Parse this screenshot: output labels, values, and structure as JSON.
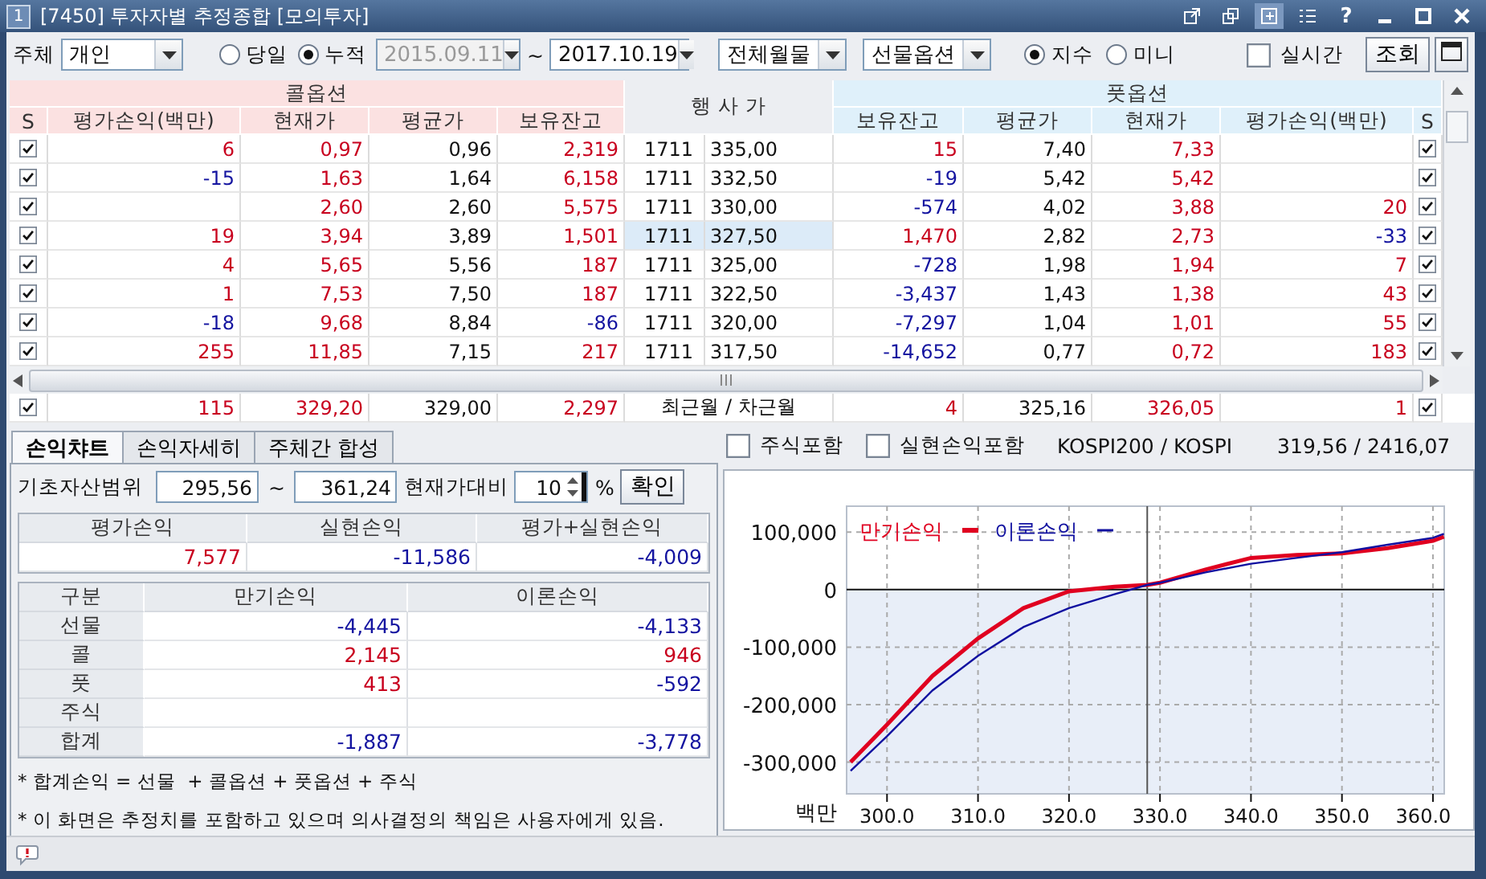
{
  "window": {
    "badge": "1",
    "title": "[7450] 투자자별 추정종합 [모의투자]",
    "help": "?"
  },
  "toolbar": {
    "subject_label": "주체",
    "subject": "개인",
    "period_radios": [
      {
        "label": "당일",
        "selected": false
      },
      {
        "label": "누적",
        "selected": true
      }
    ],
    "start_date": {
      "value": "2015.09.11",
      "disabled": true
    },
    "tilde": "~",
    "end_date": "2017.10.19",
    "month_select": "전체월물",
    "product_select": "선물옵션",
    "index_radios": [
      {
        "label": "지수",
        "selected": true
      },
      {
        "label": "미니",
        "selected": false
      }
    ],
    "realtime": {
      "label": "실시간",
      "checked": false
    },
    "query_button": "조회"
  },
  "grid": {
    "call_group": "콜옵션",
    "strike_header": "행 사 가",
    "put_group": "풋옵션",
    "call_columns": [
      "S",
      "평가손익(백만)",
      "현재가",
      "평균가",
      "보유잔고"
    ],
    "put_columns": [
      "보유잔고",
      "평균가",
      "현재가",
      "평가손익(백만)",
      "S"
    ],
    "rows": [
      {
        "call_checked": true,
        "call_pl": "6",
        "call_price": "0,97",
        "call_avg": "0,96",
        "call_balance": "2,319",
        "month": "1711",
        "strike": "335,00",
        "highlighted": false,
        "put_balance": "15",
        "put_avg": "7,40",
        "put_price": "7,33",
        "put_checked": true
      },
      {
        "call_checked": true,
        "call_pl": "-15",
        "call_price": "1,63",
        "call_avg": "1,64",
        "call_balance": "6,158",
        "month": "1711",
        "strike": "332,50",
        "highlighted": false,
        "put_balance": "-19",
        "put_avg": "5,42",
        "put_price": "5,42",
        "put_checked": true
      },
      {
        "call_checked": true,
        "call_price": "2,60",
        "call_avg": "2,60",
        "call_balance": "5,575",
        "month": "1711",
        "strike": "330,00",
        "highlighted": false,
        "put_balance": "-574",
        "put_avg": "4,02",
        "put_price": "3,88",
        "put_pl": "20",
        "put_checked": true
      },
      {
        "call_checked": true,
        "call_pl": "19",
        "call_price": "3,94",
        "call_avg": "3,89",
        "call_balance": "1,501",
        "month": "1711",
        "strike": "327,50",
        "highlighted": true,
        "put_balance": "1,470",
        "put_avg": "2,82",
        "put_price": "2,73",
        "put_pl": "-33",
        "put_checked": true
      },
      {
        "call_checked": true,
        "call_pl": "4",
        "call_price": "5,65",
        "call_avg": "5,56",
        "call_balance": "187",
        "month": "1711",
        "strike": "325,00",
        "highlighted": false,
        "put_balance": "-728",
        "put_avg": "1,98",
        "put_price": "1,94",
        "put_pl": "7",
        "put_checked": true
      },
      {
        "call_checked": true,
        "call_pl": "1",
        "call_price": "7,53",
        "call_avg": "7,50",
        "call_balance": "187",
        "month": "1711",
        "strike": "322,50",
        "highlighted": false,
        "put_balance": "-3,437",
        "put_avg": "1,43",
        "put_price": "1,38",
        "put_pl": "43",
        "put_checked": true
      },
      {
        "call_checked": true,
        "call_pl": "-18",
        "call_price": "9,68",
        "call_avg": "8,84",
        "call_balance": "-86",
        "month": "1711",
        "strike": "320,00",
        "highlighted": false,
        "put_balance": "-7,297",
        "put_avg": "1,04",
        "put_price": "1,01",
        "put_pl": "55",
        "put_checked": true
      },
      {
        "call_checked": true,
        "call_pl": "255",
        "call_price": "11,85",
        "call_avg": "7,15",
        "call_balance": "217",
        "month": "1711",
        "strike": "317,50",
        "highlighted": false,
        "put_balance": "-14,652",
        "put_avg": "0,77",
        "put_price": "0,72",
        "put_pl": "183",
        "put_checked": true
      }
    ],
    "total": {
      "call_checked": true,
      "call_pl": "115",
      "call_price": "329,20",
      "call_avg": "329,00",
      "call_balance": "2,297",
      "label": "최근월 / 차근월",
      "put_balance": "4",
      "put_avg": "325,16",
      "put_price": "326,05",
      "put_pl": "1",
      "put_checked": true
    }
  },
  "pl_panel": {
    "tabs": [
      {
        "label": "손익챠트",
        "selected": true
      },
      {
        "label": "손익자세히",
        "selected": false
      },
      {
        "label": "주체간 합성",
        "selected": false
      }
    ],
    "range": {
      "label": "기초자산범위",
      "from": "295,56",
      "tilde": "~",
      "to": "361,24",
      "compare_label": "현재가대비",
      "percent": "10",
      "percent_sign": "%",
      "confirm": "확인"
    },
    "summary": {
      "columns": [
        "평가손익",
        "실현손익",
        "평가+실현손익"
      ],
      "values": [
        "7,577",
        "-11,586",
        "-4,009"
      ]
    },
    "breakdown": {
      "columns": [
        "구분",
        "만기손익",
        "이론손익"
      ],
      "rows": [
        {
          "label": "선물",
          "expiry": "-4,445",
          "theory": "-4,133"
        },
        {
          "label": "콜",
          "expiry": "2,145",
          "theory": "946"
        },
        {
          "label": "풋",
          "expiry": "413",
          "theory": "-592"
        },
        {
          "label": "주식"
        },
        {
          "label": "합계",
          "expiry": "-1,887",
          "theory": "-3,778"
        }
      ]
    },
    "notes": [
      "* 합계손익 = 선물  + 콜옵션 + 풋옵션 + 주식",
      "* 이 화면은 추정치를 포함하고 있으며 의사결정의 책임은 사용자에게 있음."
    ]
  },
  "chart_panel": {
    "stock_include": {
      "label": "주식포함",
      "checked": false
    },
    "realized_include": {
      "label": "실현손익포함",
      "checked": false
    },
    "index_label": "KOSPI200 / KOSPI",
    "index_value": "319,56 / 2416,07",
    "chart_data": {
      "type": "line",
      "ylabel": "백만",
      "x": [
        296,
        300,
        305,
        310,
        315,
        320,
        325,
        328.6,
        330,
        335,
        340,
        345,
        350,
        355,
        360,
        361.2
      ],
      "series": [
        {
          "name": "만기손익",
          "color": "#e00020",
          "values": [
            -300000,
            -235000,
            -150000,
            -85000,
            -32000,
            -3000,
            5000,
            8000,
            12000,
            35000,
            55000,
            60000,
            63000,
            72000,
            85000,
            92000
          ]
        },
        {
          "name": "이론손익",
          "color": "#1010a0",
          "values": [
            -315000,
            -255000,
            -175000,
            -115000,
            -65000,
            -32000,
            -8000,
            8000,
            12000,
            30000,
            45000,
            55000,
            65000,
            78000,
            90000,
            97000
          ]
        }
      ],
      "xlim": [
        295.56,
        361.24
      ],
      "ylim": [
        -355000,
        145000
      ],
      "xticks": [
        {
          "value": 300,
          "label": "300.0"
        },
        {
          "value": 310,
          "label": "310.0"
        },
        {
          "value": 320,
          "label": "320.0"
        },
        {
          "value": 330,
          "label": "330.0"
        },
        {
          "value": 340,
          "label": "340.0"
        },
        {
          "value": 350,
          "label": "350.0"
        },
        {
          "value": 360,
          "label": "360.0"
        }
      ],
      "yticks": [
        {
          "value": -300000,
          "label": "-300,000"
        },
        {
          "value": -200000,
          "label": "-200,000"
        },
        {
          "value": -100000,
          "label": "-100,000"
        },
        {
          "value": 0,
          "label": "0"
        },
        {
          "value": 100000,
          "label": "100,000"
        }
      ],
      "grid": true,
      "legend": true,
      "ref_lines": [
        {
          "axis": "x",
          "value": 328.6,
          "color": "#555555"
        }
      ],
      "bands": [
        {
          "axis": "y",
          "from": -355000,
          "to": 0,
          "color": "#e8eef8"
        }
      ]
    }
  }
}
